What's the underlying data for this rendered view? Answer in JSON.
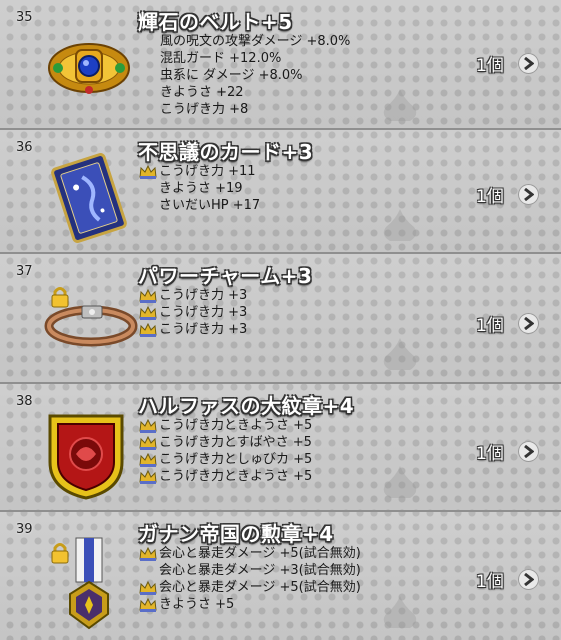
{
  "items": [
    {
      "num": "35",
      "title": "輝石のベルト+5",
      "qty": "1個",
      "stats": [
        {
          "crown": false,
          "text": "風の呪文の攻撃ダメージ +8.0%"
        },
        {
          "crown": false,
          "text": "混乱ガード +12.0%"
        },
        {
          "crown": false,
          "text": "虫系に ダメージ +8.0%"
        },
        {
          "crown": false,
          "text": "きようさ +22"
        },
        {
          "crown": false,
          "text": "こうげき力 +8"
        }
      ]
    },
    {
      "num": "36",
      "title": "不思議のカード+3",
      "qty": "1個",
      "stats": [
        {
          "crown": true,
          "text": "こうげき力 +11"
        },
        {
          "crown": false,
          "text": "きようさ +19"
        },
        {
          "crown": false,
          "text": "さいだいHP +17"
        }
      ]
    },
    {
      "num": "37",
      "title": "パワーチャーム+3",
      "qty": "1個",
      "stats": [
        {
          "crown": true,
          "text": "こうげき力 +3"
        },
        {
          "crown": true,
          "text": "こうげき力 +3"
        },
        {
          "crown": true,
          "text": "こうげき力 +3"
        }
      ]
    },
    {
      "num": "38",
      "title": "ハルファスの大紋章+4",
      "qty": "1個",
      "stats": [
        {
          "crown": true,
          "text": "こうげき力ときようさ +5"
        },
        {
          "crown": true,
          "text": "こうげき力とすばやさ +5"
        },
        {
          "crown": true,
          "text": "こうげき力としゅびカ +5"
        },
        {
          "crown": true,
          "text": "こうげき力ときようさ +5"
        }
      ]
    },
    {
      "num": "39",
      "title": "ガナン帝国の勲章+4",
      "qty": "1個",
      "stats": [
        {
          "crown": true,
          "text": "会心と暴走ダメージ +5(試合無効)"
        },
        {
          "crown": false,
          "text": "会心と暴走ダメージ +3(試合無効)"
        },
        {
          "crown": true,
          "text": "会心と暴走ダメージ +5(試合無効)"
        },
        {
          "crown": true,
          "text": "きようさ +5"
        }
      ]
    }
  ],
  "icons": {
    "chevron": "chevron-right-icon",
    "lock": "lock-icon",
    "crown": "crown-icon"
  },
  "colors": {
    "background": "#cbcbcb",
    "divider": "#8f8f8f",
    "title_fill": "#ffffff",
    "title_outline": "#333333"
  }
}
